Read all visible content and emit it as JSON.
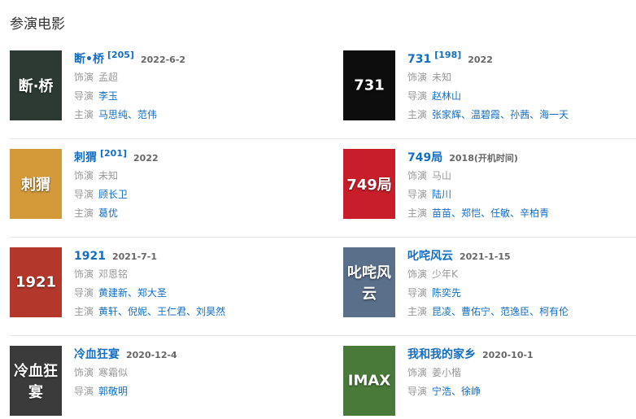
{
  "section_title": "参演电影",
  "films": [
    {
      "title": "断•桥",
      "count": "[205]",
      "date": "2022-6-2",
      "role_label": "饰演",
      "role": "孟超",
      "director_label": "导演",
      "directors": [
        "李玉"
      ],
      "cast_label": "主演",
      "cast": [
        "马思纯",
        "范伟"
      ],
      "poster_color": "#2c3a33",
      "poster_text": "断·桥"
    },
    {
      "title": "731",
      "count": "[198]",
      "date": "2022",
      "role_label": "饰演",
      "role": "未知",
      "director_label": "导演",
      "directors": [
        "赵林山"
      ],
      "cast_label": "主演",
      "cast": [
        "张家辉",
        "温碧霞",
        "孙茜",
        "海一天"
      ],
      "poster_color": "#0d0d0d",
      "poster_text": "731"
    },
    {
      "title": "刺猬",
      "count": "[201]",
      "date": "2022",
      "role_label": "饰演",
      "role": "未知",
      "director_label": "导演",
      "directors": [
        "顾长卫"
      ],
      "cast_label": "主演",
      "cast": [
        "葛优"
      ],
      "poster_color": "#d49a3a",
      "poster_text": "刺猬"
    },
    {
      "title": "749局",
      "count": "",
      "date": "2018(开机时间)",
      "role_label": "饰演",
      "role": "马山",
      "director_label": "导演",
      "directors": [
        "陆川"
      ],
      "cast_label": "主演",
      "cast": [
        "苗苗",
        "郑恺",
        "任敏",
        "辛柏青"
      ],
      "poster_color": "#c81e2a",
      "poster_text": "749局"
    },
    {
      "title": "1921",
      "count": "",
      "date": "2021-7-1",
      "role_label": "饰演",
      "role": "邓恩铭",
      "director_label": "导演",
      "directors": [
        "黄建新",
        "郑大圣"
      ],
      "cast_label": "主演",
      "cast": [
        "黄轩",
        "倪妮",
        "王仁君",
        "刘昊然"
      ],
      "poster_color": "#b3372b",
      "poster_text": "1921"
    },
    {
      "title": "叱咤风云",
      "count": "",
      "date": "2021-1-15",
      "role_label": "饰演",
      "role": "少年K",
      "director_label": "导演",
      "directors": [
        "陈奕先"
      ],
      "cast_label": "主演",
      "cast": [
        "昆凌",
        "曹佑宁",
        "范逸臣",
        "柯有伦"
      ],
      "poster_color": "#5a6f8a",
      "poster_text": "叱咤风云"
    },
    {
      "title": "冷血狂宴",
      "count": "",
      "date": "2020-12-4",
      "role_label": "饰演",
      "role": "寒霜似",
      "director_label": "导演",
      "directors": [
        "郭敬明"
      ],
      "cast_label": "主演",
      "cast": [],
      "poster_color": "#3b3b3b",
      "poster_text": "冷血狂宴"
    },
    {
      "title": "我和我的家乡",
      "count": "",
      "date": "2020-10-1",
      "role_label": "饰演",
      "role": "姜小楷",
      "director_label": "导演",
      "directors": [
        "宁浩",
        "徐峥"
      ],
      "cast_label": "主演",
      "cast": [],
      "poster_color": "#4a7a3a",
      "poster_text": "IMAX"
    }
  ]
}
